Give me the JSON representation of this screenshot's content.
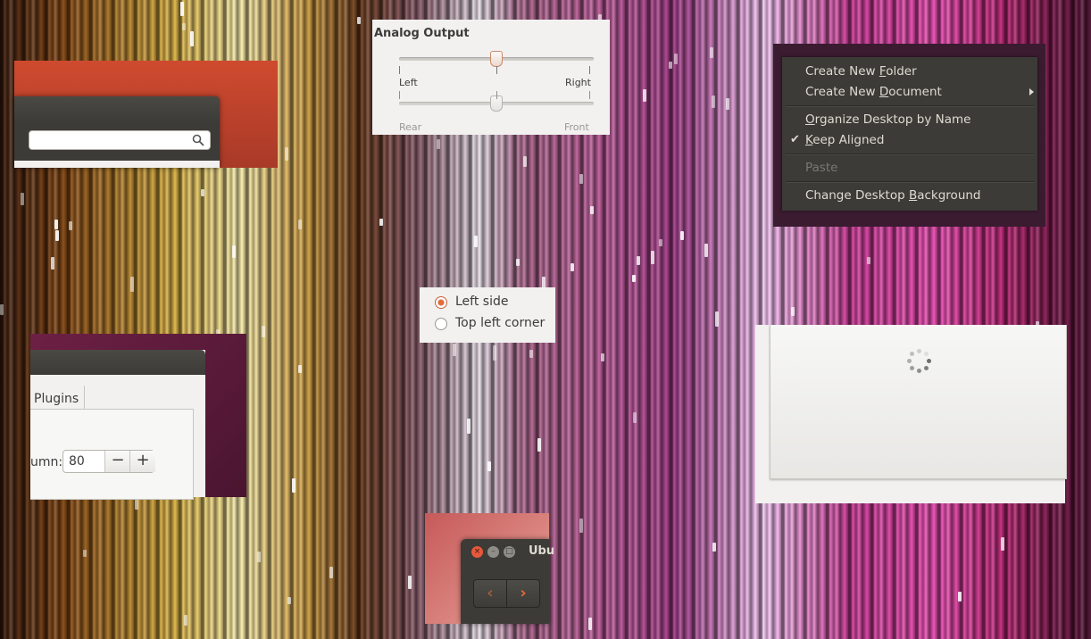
{
  "search": {
    "icon": "search-icon",
    "value": ""
  },
  "analog": {
    "title": "Analog Output",
    "balance": {
      "left_label": "Left",
      "right_label": "Right",
      "value": 0.5
    },
    "fade": {
      "rear_label": "Rear",
      "front_label": "Front",
      "value": 0.5,
      "disabled": true
    }
  },
  "context_menu": {
    "items": [
      {
        "pre": "Create New ",
        "acc": "F",
        "post": "older",
        "enabled": true,
        "checked": false,
        "submenu": false
      },
      {
        "pre": "Create New ",
        "acc": "D",
        "post": "ocument",
        "enabled": true,
        "checked": false,
        "submenu": true
      },
      {
        "pre": "",
        "acc": "O",
        "post": "rganize Desktop by Name",
        "enabled": true,
        "checked": false,
        "submenu": false
      },
      {
        "pre": "",
        "acc": "K",
        "post": "eep Aligned",
        "enabled": true,
        "checked": true,
        "submenu": false
      },
      {
        "pre": "Paste",
        "acc": "",
        "post": "",
        "enabled": false,
        "checked": false,
        "submenu": false
      },
      {
        "pre": "Change Desktop ",
        "acc": "B",
        "post": "ackground",
        "enabled": true,
        "checked": false,
        "submenu": false
      }
    ],
    "check_glyph": "✔"
  },
  "radio_group": {
    "options": [
      {
        "label": "Left side",
        "selected": true
      },
      {
        "label": "Top left corner",
        "selected": false
      }
    ]
  },
  "plugins_window": {
    "tab_label": "Plugins",
    "field_label": "umn:",
    "value": "80",
    "minus": "−",
    "plus": "+"
  },
  "nav_window": {
    "title": "Ubu",
    "back_glyph": "‹",
    "forward_glyph": "›",
    "close_glyph": "×",
    "min_glyph": "–",
    "max_glyph": "□"
  },
  "colors": {
    "accent": "#e26b3c",
    "menu_bg": "#3c3b37",
    "window_light": "#f2f1f0",
    "title_dark": "#3c3b37"
  }
}
